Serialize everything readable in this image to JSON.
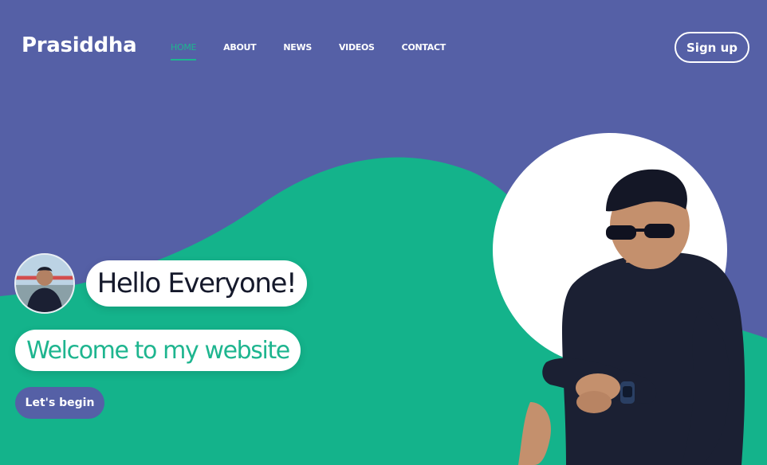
{
  "header": {
    "brand": "Prasiddha",
    "nav": [
      {
        "label": "HOME",
        "active": true
      },
      {
        "label": "ABOUT",
        "active": false
      },
      {
        "label": "NEWS",
        "active": false
      },
      {
        "label": "VIDEOS",
        "active": false
      },
      {
        "label": "CONTACT",
        "active": false
      }
    ],
    "signup_label": "Sign up"
  },
  "hero": {
    "greeting": "Hello Everyone!",
    "welcome": "Welcome to my website",
    "cta_label": "Let's begin",
    "avatar_icon": "profile-photo",
    "portrait_icon": "person-photo"
  },
  "colors": {
    "primary_purple": "#5560a6",
    "accent_green": "#1eb58f",
    "white": "#ffffff",
    "text_dark": "#15192b"
  }
}
